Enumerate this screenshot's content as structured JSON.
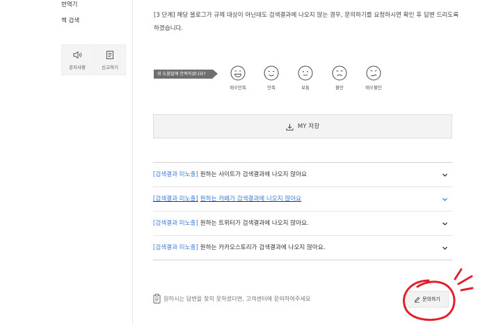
{
  "sidebar": {
    "links": [
      "번역기",
      "책 검색"
    ],
    "buttons": [
      {
        "label": "공지사항",
        "icon": "speaker-icon"
      },
      {
        "label": "신고하기",
        "icon": "document-icon"
      }
    ]
  },
  "main": {
    "step_text": "[3 단계] 해당 블로그가 규제 대상이 아닌데도 검색결과에 나오지 않는 경우, 문의하기를 요청하시면 확인 후 답변 드리도록 하겠습니다.",
    "satisfaction": {
      "prompt": "위 도움말에 만족하셨나요?",
      "options": [
        "매우만족",
        "만족",
        "보통",
        "불만",
        "매우불만"
      ]
    },
    "save_label": "MY 저장",
    "faq": [
      {
        "category": "[검색결과 미노출]",
        "question": "원하는 사이트가 검색결과에 나오지 않아요",
        "active": false
      },
      {
        "category": "[검색결과 미노출]",
        "question": "원하는 카페가 검색결과에 나오지 않아요",
        "active": true
      },
      {
        "category": "[검색결과 미노출]",
        "question": "원하는 트위터가 검색결과에 나오지 않아요.",
        "active": false
      },
      {
        "category": "[검색결과 미노출]",
        "question": "원하는 카카오스토리가 검색결과에 나오지 않아요.",
        "active": false
      }
    ],
    "help_text": "원하시는 답변을 찾지 못하셨다면, 고객센터에 문의하여주세요",
    "ask_label": "문의하기"
  },
  "colors": {
    "link_blue": "#3c79d6",
    "annotation_red": "#e0202a",
    "tag_gray": "#6f6f6f"
  }
}
